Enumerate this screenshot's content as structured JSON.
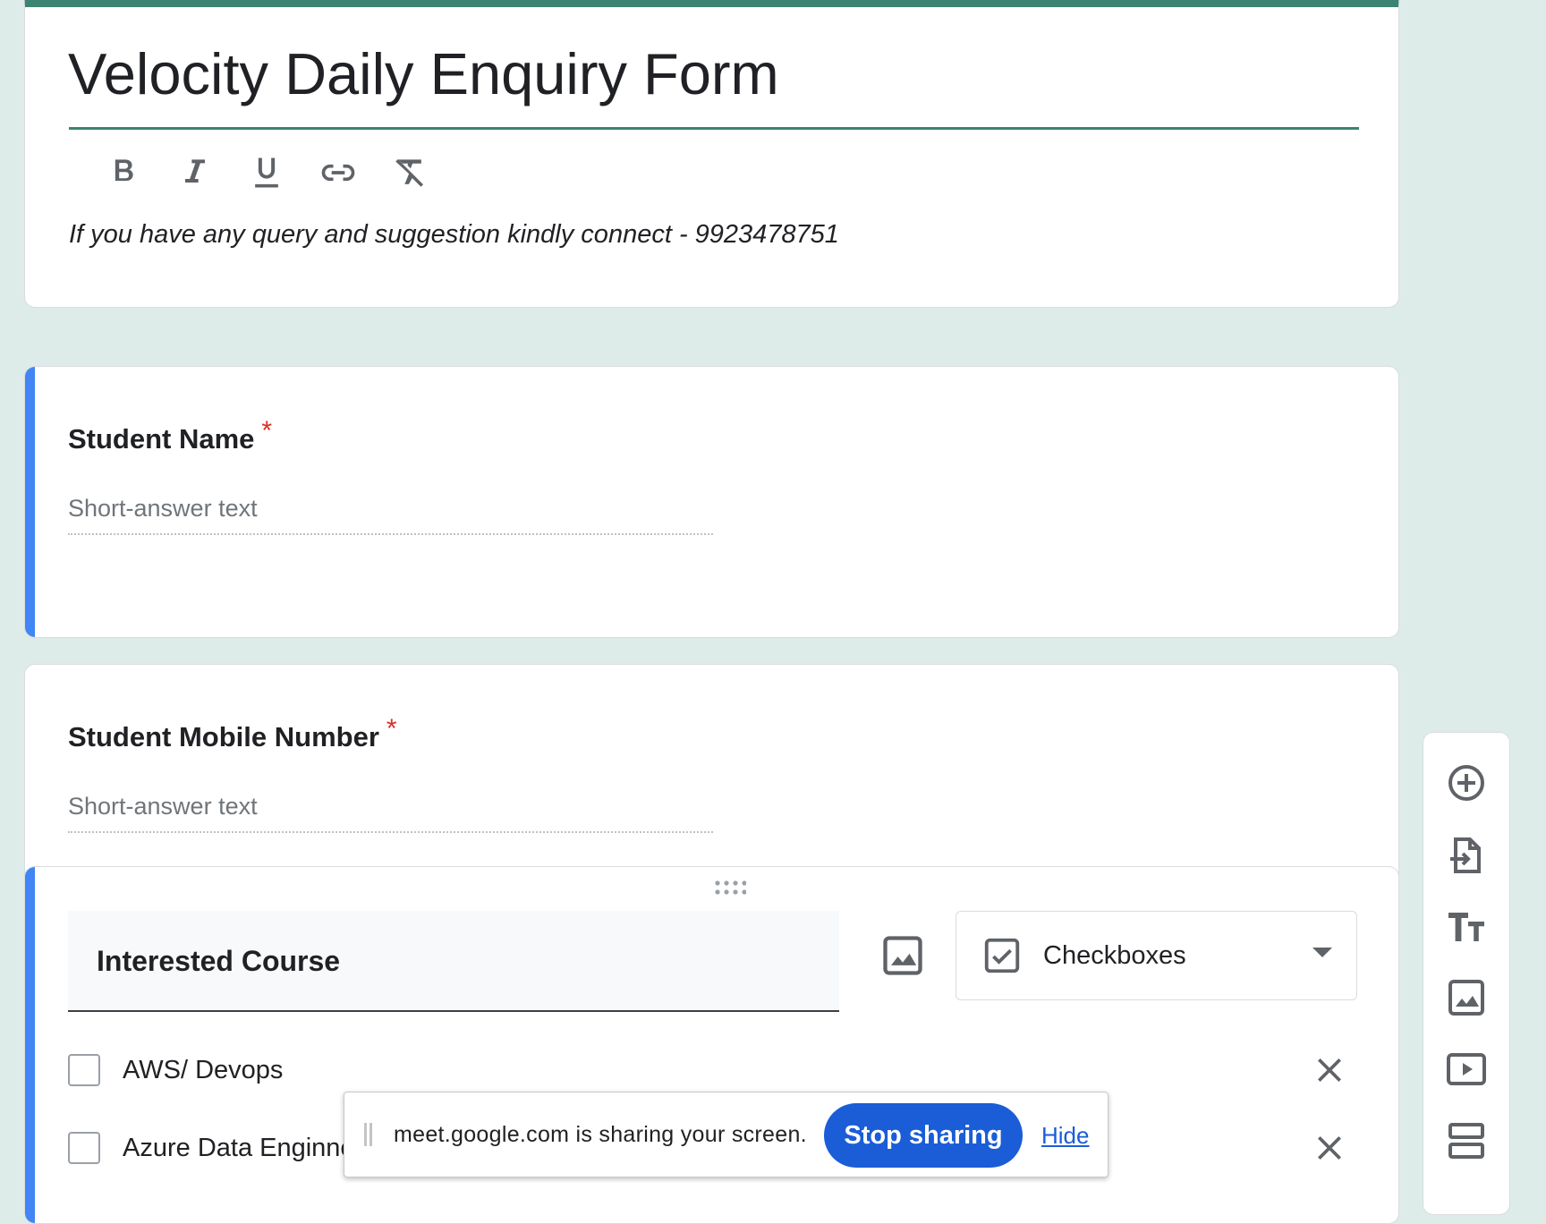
{
  "form": {
    "title": "Velocity Daily Enquiry Form",
    "description": "If you have any query and suggestion kindly connect - 9923478751",
    "accent_color": "#3b8472",
    "toolbar": {
      "bold": "bold-icon",
      "italic": "italic-icon",
      "underline": "underline-icon",
      "link": "link-icon",
      "clear": "clear-formatting-icon"
    }
  },
  "questions": [
    {
      "label": "Student Name",
      "required_mark": "*",
      "placeholder": "Short-answer text"
    },
    {
      "label": "Student Mobile Number",
      "required_mark": "*",
      "placeholder": "Short-answer text"
    }
  ],
  "course_question": {
    "label": "Interested Course",
    "type": "Checkboxes",
    "options": [
      {
        "label": "AWS/ Devops"
      },
      {
        "label": "Azure Data Enginne"
      }
    ]
  },
  "side_toolbar": [
    "add-question-icon",
    "import-questions-icon",
    "add-title-icon",
    "add-image-icon",
    "add-video-icon",
    "add-section-icon"
  ],
  "share_bar": {
    "message": "meet.google.com is sharing your screen.",
    "stop_label": "Stop sharing",
    "hide_label": "Hide"
  }
}
